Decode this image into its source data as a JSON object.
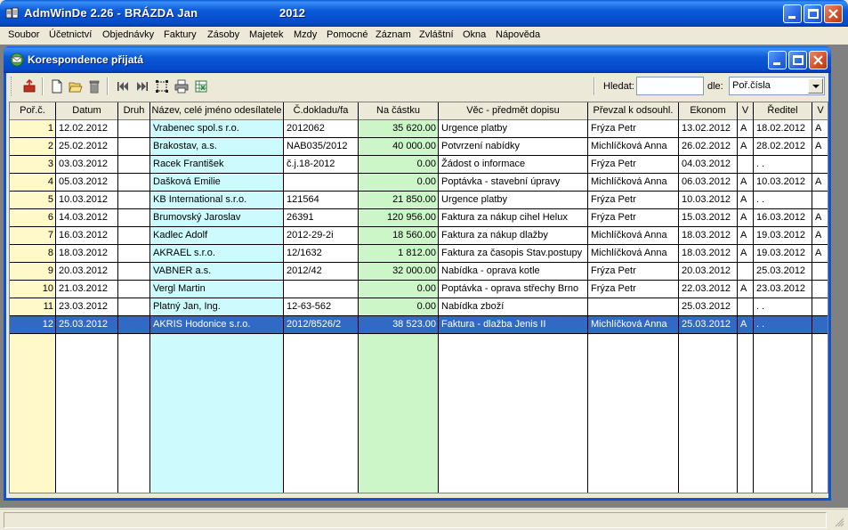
{
  "app": {
    "title": "AdmWinDe 2.26 - BRÁZDA Jan",
    "year": "2012"
  },
  "menu": [
    "Soubor",
    "Účetnictví",
    "Objednávky",
    "Faktury",
    "Zásoby",
    "Majetek",
    "Mzdy",
    "Pomocné",
    "Záznam",
    "Zvláštní",
    "Okna",
    "Nápověda"
  ],
  "window": {
    "title": "Korespondence přijatá"
  },
  "toolbar": {
    "icons": [
      "exit-icon",
      "new-document-icon",
      "open-folder-icon",
      "delete-icon",
      "first-record-icon",
      "last-record-icon",
      "select-area-icon",
      "print-icon",
      "excel-export-icon"
    ],
    "search_label": "Hledat:",
    "search_value": "",
    "by_label": "dle:",
    "by_value": "Poř.čísla"
  },
  "table": {
    "columns": [
      "Poř.č.",
      "Datum",
      "Druh",
      "Název, celé jméno odesílatele",
      "Č.dokladu/fa",
      "Na částku",
      "Věc - předmět dopisu",
      "Převzal k odsouhl.",
      "Ekonom",
      "V",
      "Ředitel",
      "V"
    ],
    "rows": [
      [
        "1",
        "12.02.2012",
        "",
        "Vrabenec spol.s r.o.",
        "2012062",
        "35 620.00",
        "Urgence platby",
        "Frýza Petr",
        "13.02.2012",
        "A",
        "18.02.2012",
        "A"
      ],
      [
        "2",
        "25.02.2012",
        "",
        "Brakostav, a.s.",
        "NAB035/2012",
        "40 000.00",
        "Potvrzení nabídky",
        "Michlíčková Anna",
        "26.02.2012",
        "A",
        "28.02.2012",
        "A"
      ],
      [
        "3",
        "03.03.2012",
        "",
        "Racek František",
        "č.j.18-2012",
        "0.00",
        "Žádost o informace",
        "Frýza Petr",
        "04.03.2012",
        "",
        ". .",
        ""
      ],
      [
        "4",
        "05.03.2012",
        "",
        "Dašková Emilie",
        "",
        "0.00",
        "Poptávka - stavební úpravy",
        "Michlíčková Anna",
        "06.03.2012",
        "A",
        "10.03.2012",
        "A"
      ],
      [
        "5",
        "10.03.2012",
        "",
        "KB International s.r.o.",
        "121564",
        "21 850.00",
        "Urgence platby",
        "Frýza Petr",
        "10.03.2012",
        "A",
        ". .",
        ""
      ],
      [
        "6",
        "14.03.2012",
        "",
        "Brumovský Jaroslav",
        "26391",
        "120 956.00",
        "Faktura za nákup cihel Helux",
        "Frýza Petr",
        "15.03.2012",
        "A",
        "16.03.2012",
        "A"
      ],
      [
        "7",
        "16.03.2012",
        "",
        "Kadlec  Adolf",
        "2012-29-2i",
        "18 560.00",
        "Faktura za nákup dlažby",
        "Michlíčková Anna",
        "18.03.2012",
        "A",
        "19.03.2012",
        "A"
      ],
      [
        "8",
        "18.03.2012",
        "",
        "AKRAEL s.r.o.",
        "12/1632",
        "1 812.00",
        "Faktura za časopis Stav.postupy",
        "Michlíčková Anna",
        "18.03.2012",
        "A",
        "19.03.2012",
        "A"
      ],
      [
        "9",
        "20.03.2012",
        "",
        "VABNER a.s.",
        "2012/42",
        "32 000.00",
        "Nabídka - oprava kotle",
        "Frýza Petr",
        "20.03.2012",
        "",
        "25.03.2012",
        ""
      ],
      [
        "10",
        "21.03.2012",
        "",
        "Vergl Martin",
        "",
        "0.00",
        "Poptávka - oprava střechy Brno",
        "Frýza Petr",
        "22.03.2012",
        "A",
        "23.03.2012",
        ""
      ],
      [
        "11",
        "23.03.2012",
        "",
        "Platný Jan, Ing.",
        "12-63-562",
        "0.00",
        "Nabídka zboží",
        "",
        "25.03.2012",
        "",
        ". .",
        ""
      ],
      [
        "12",
        "25.03.2012",
        "",
        "AKRIS Hodonice s.r.o.",
        "2012/8526/2",
        "38 523.00",
        "Faktura - dlažba Jenis II",
        "Michlíčková Anna",
        "25.03.2012",
        "A",
        ". .",
        ""
      ]
    ],
    "selected_row": 11
  },
  "colors": {
    "titlebar": "#0b5ad8",
    "selection": "#316ac5",
    "col_number_bg": "#fff8c8",
    "col_sender_bg": "#ccfafd",
    "col_amount_bg": "#ccf5c8"
  }
}
